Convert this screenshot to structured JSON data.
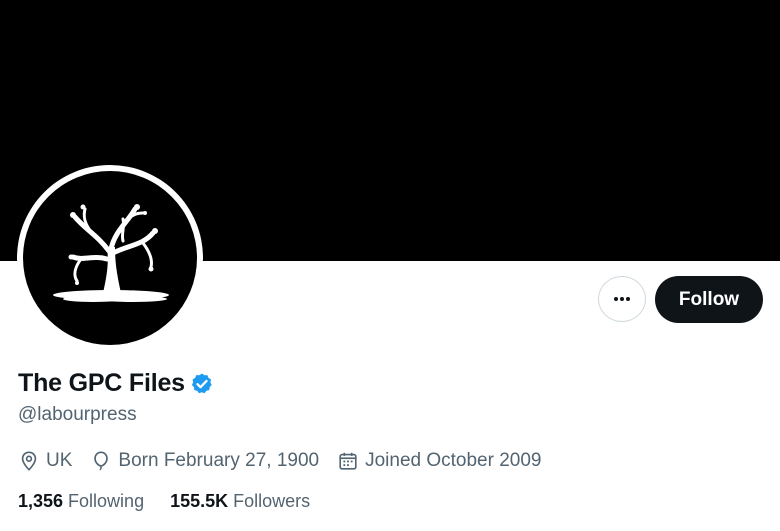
{
  "profile": {
    "display_name": "The GPC Files",
    "handle": "@labourpress",
    "verified_icon": "verified-badge-icon",
    "location": "UK",
    "birthday": "Born February 27, 1900",
    "joined": "Joined October 2009"
  },
  "actions": {
    "more_icon": "more-horizontal-icon",
    "follow_label": "Follow"
  },
  "stats": {
    "following_count": "1,356",
    "following_label": "Following",
    "followers_count": "155.5K",
    "followers_label": "Followers"
  },
  "colors": {
    "banner": "#000000",
    "follow_bg": "#0f1419",
    "secondary_text": "#536471",
    "verified": "#1d9bf0"
  }
}
